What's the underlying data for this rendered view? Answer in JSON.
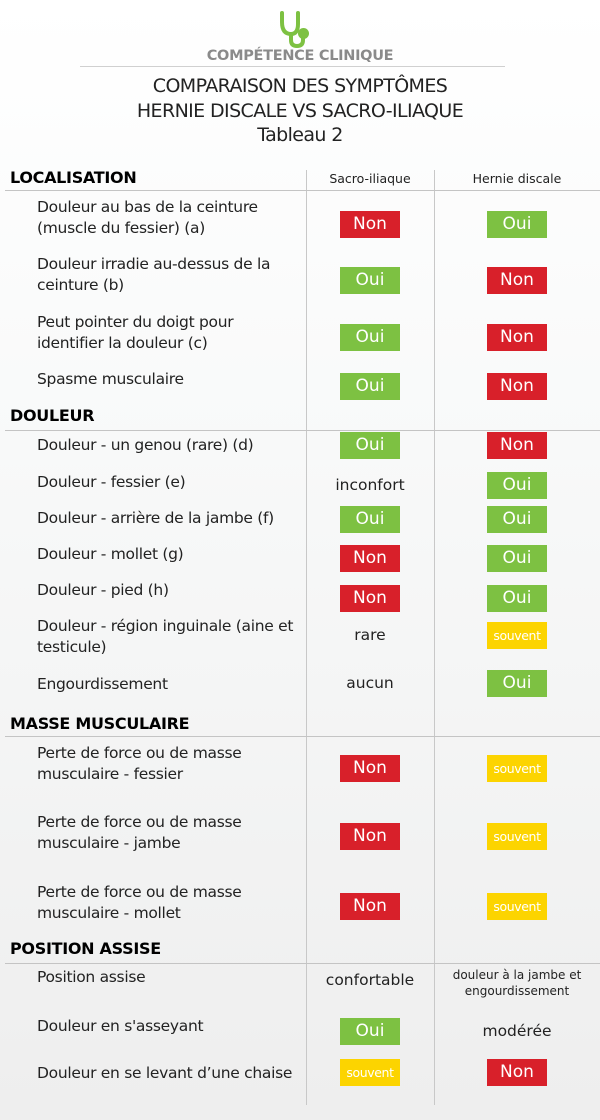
{
  "header": {
    "logo_icon": "stethoscope-icon",
    "brand": "COMPÉTENCE CLINIQUE",
    "title_line1": "COMPARAISON DES SYMPTÔMES",
    "title_line2": "HERNIE DISCALE VS SACRO-ILIAQUE",
    "title_line3": "Tableau 2"
  },
  "colors": {
    "oui": "#7dc142",
    "non": "#d8202a",
    "souvent": "#fcd400",
    "brand": "#7dc142"
  },
  "columns": {
    "col1": "Sacro-iliaque",
    "col2": "Hernie discale"
  },
  "sections": [
    {
      "title": "LOCALISATION",
      "rows": [
        {
          "label": "Douleur au bas de la ceinture (muscle du fessier) (a)",
          "a": "Non",
          "b": "Oui"
        },
        {
          "label": "Douleur irradie au-dessus de la ceinture (b)",
          "a": "Oui",
          "b": "Non"
        },
        {
          "label": "Peut pointer du doigt pour identifier la douleur (c)",
          "a": "Oui",
          "b": "Non"
        },
        {
          "label": "Spasme musculaire",
          "a": "Oui",
          "b": "Non"
        }
      ]
    },
    {
      "title": "DOULEUR",
      "rows": [
        {
          "label": "Douleur - un genou (rare) (d)",
          "a": "Oui",
          "b": "Non"
        },
        {
          "label": "Douleur - fessier (e)",
          "a": "inconfort",
          "b": "Oui"
        },
        {
          "label": "Douleur - arrière de la jambe (f)",
          "a": "Oui",
          "b": "Oui"
        },
        {
          "label": "Douleur - mollet (g)",
          "a": "Non",
          "b": "Oui"
        },
        {
          "label": "Douleur - pied (h)",
          "a": "Non",
          "b": "Oui"
        },
        {
          "label": "Douleur - région inguinale (aine et testicule)",
          "a": "rare",
          "b": "souvent"
        },
        {
          "label": "Engourdissement",
          "a": "aucun",
          "b": "Oui"
        }
      ]
    },
    {
      "title": "MASSE MUSCULAIRE",
      "rows": [
        {
          "label": "Perte de force ou de masse musculaire  - fessier",
          "a": "Non",
          "b": "souvent"
        },
        {
          "label": "Perte de force ou de masse musculaire - jambe",
          "a": "Non",
          "b": "souvent"
        },
        {
          "label": "Perte de force ou de masse musculaire - mollet",
          "a": "Non",
          "b": "souvent"
        }
      ]
    },
    {
      "title": "POSITION ASSISE",
      "rows": [
        {
          "label": "Position assise",
          "a": "confortable",
          "b": "douleur à la jambe et engourdissement"
        },
        {
          "label": "Douleur en s'asseyant",
          "a": "Oui",
          "b": "modérée"
        },
        {
          "label": "Douleur en se levant d’une chaise",
          "a": "souvent",
          "b": "Non"
        }
      ]
    }
  ]
}
